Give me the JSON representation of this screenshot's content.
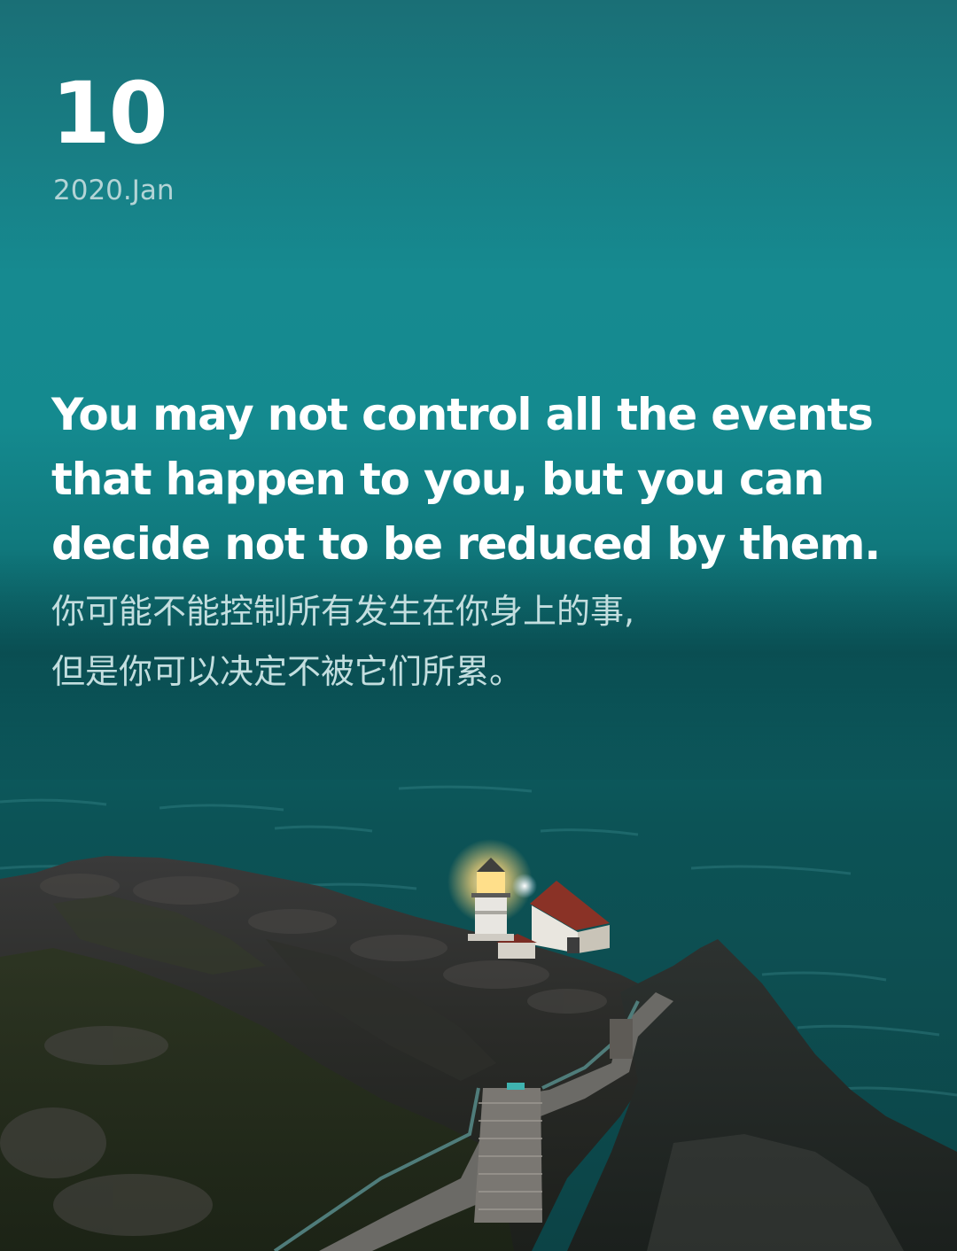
{
  "card": {
    "day": "10",
    "month_year": "2020.Jan",
    "quote_en": "You may not control all the events that happen to you, but you can decide not to be reduced by them.",
    "quote_zh_lines": [
      "你可能不能控制所有发生在你身上的事,",
      "但是你可以决定不被它们所累。"
    ]
  },
  "colors": {
    "sky_top": "#1a6f76",
    "sky_mid": "#148a8f",
    "sea": "#0d4f52",
    "text_primary": "#ffffff",
    "text_secondary": "#b3d4d6"
  }
}
